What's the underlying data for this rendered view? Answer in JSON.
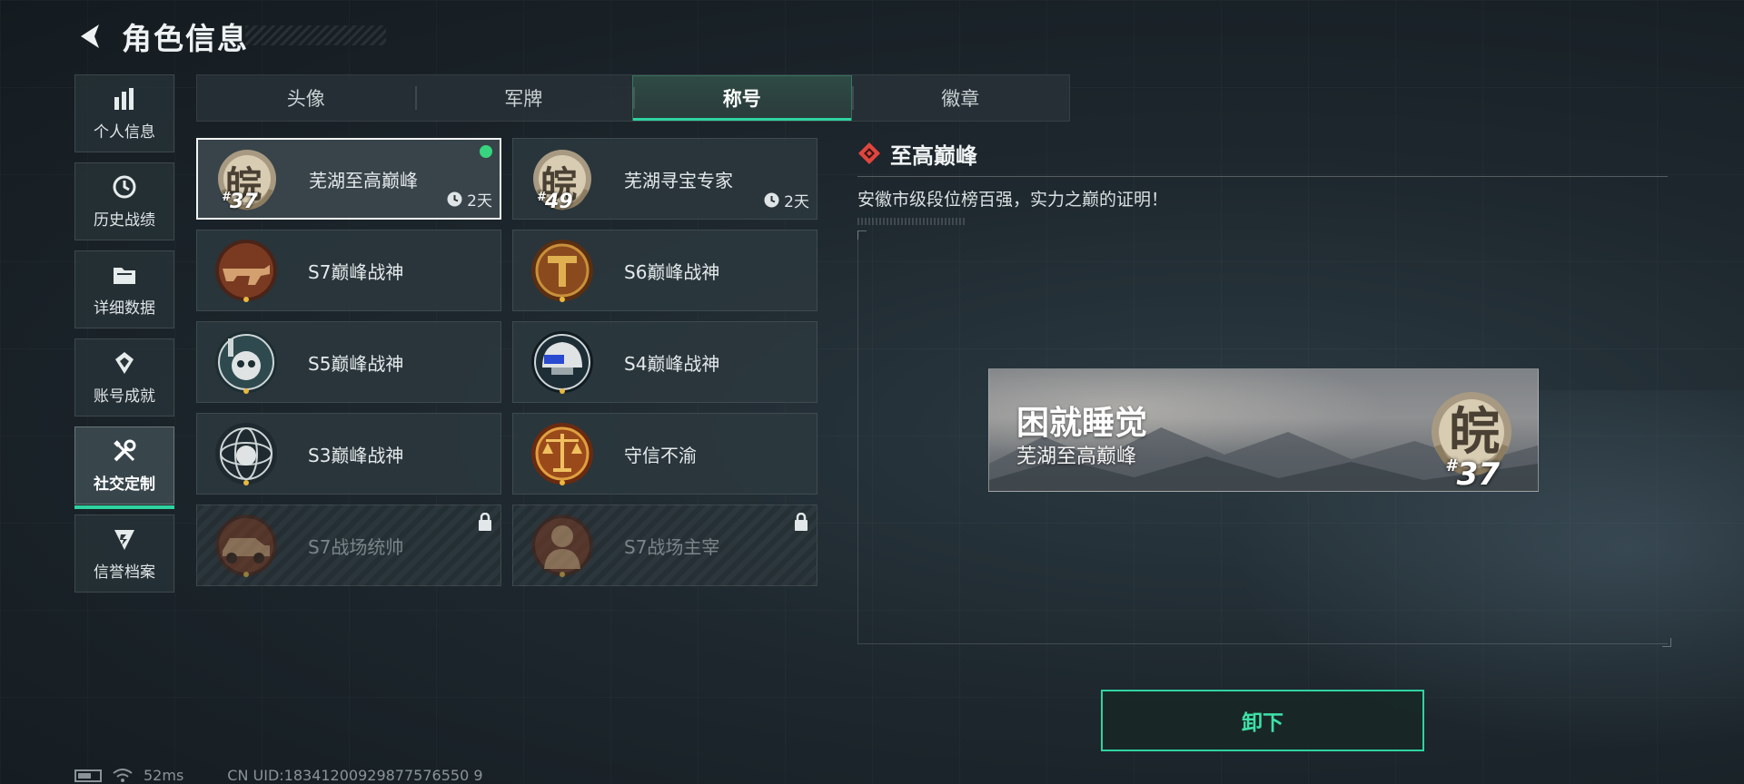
{
  "header": {
    "title": "角色信息"
  },
  "sidebar": {
    "items": [
      {
        "label": "个人信息",
        "icon": "bar-chart-icon",
        "active": false
      },
      {
        "label": "历史战绩",
        "icon": "history-clock-icon",
        "active": false
      },
      {
        "label": "详细数据",
        "icon": "folder-icon",
        "active": false
      },
      {
        "label": "账号成就",
        "icon": "achievement-icon",
        "active": false
      },
      {
        "label": "社交定制",
        "icon": "wrench-screwdriver-icon",
        "active": true
      },
      {
        "label": "信誉档案",
        "icon": "credit-shield-icon",
        "active": false
      }
    ]
  },
  "tabs": [
    {
      "label": "头像",
      "active": false
    },
    {
      "label": "军牌",
      "active": false
    },
    {
      "label": "称号",
      "active": true
    },
    {
      "label": "徽章",
      "active": false
    }
  ],
  "titles": [
    {
      "label": "芜湖至高巅峰",
      "icon": "wan-emblem-icon",
      "badge_num": "37",
      "time": "2天",
      "selected": true,
      "equipped": true,
      "locked": false
    },
    {
      "label": "芜湖寻宝专家",
      "icon": "wan-emblem-icon",
      "badge_num": "49",
      "time": "2天",
      "selected": false,
      "equipped": false,
      "locked": false
    },
    {
      "label": "S7巅峰战神",
      "icon": "rifle-emblem-icon",
      "selected": false,
      "locked": false
    },
    {
      "label": "S6巅峰战神",
      "icon": "shield-t-emblem-icon",
      "selected": false,
      "locked": false
    },
    {
      "label": "S5巅峰战神",
      "icon": "diver-skull-emblem-icon",
      "selected": false,
      "locked": false
    },
    {
      "label": "S4巅峰战神",
      "icon": "nightvision-helmet-emblem-icon",
      "selected": false,
      "locked": false
    },
    {
      "label": "S3巅峰战神",
      "icon": "globe-skull-emblem-icon",
      "selected": false,
      "locked": false
    },
    {
      "label": "守信不渝",
      "icon": "scales-emblem-icon",
      "selected": false,
      "locked": false
    },
    {
      "label": "S7战场统帅",
      "icon": "vehicle-emblem-icon",
      "selected": false,
      "locked": true
    },
    {
      "label": "S7战场主宰",
      "icon": "soldier-emblem-icon",
      "selected": false,
      "locked": true
    }
  ],
  "detail": {
    "title": "至高巅峰",
    "description": "安徽市级段位榜百强，实力之巅的证明！"
  },
  "nameplate": {
    "player_name": "困就睡觉",
    "title": "芜湖至高巅峰",
    "badge_char": "皖",
    "badge_num": "37"
  },
  "actions": {
    "unequip_label": "卸下"
  },
  "status": {
    "ping": "52ms",
    "uid": "CN UID:18341200929877576550 9"
  },
  "colors": {
    "accent": "#2fd3a0",
    "equipped": "#36d47e",
    "detail_icon": "#e0463e"
  }
}
